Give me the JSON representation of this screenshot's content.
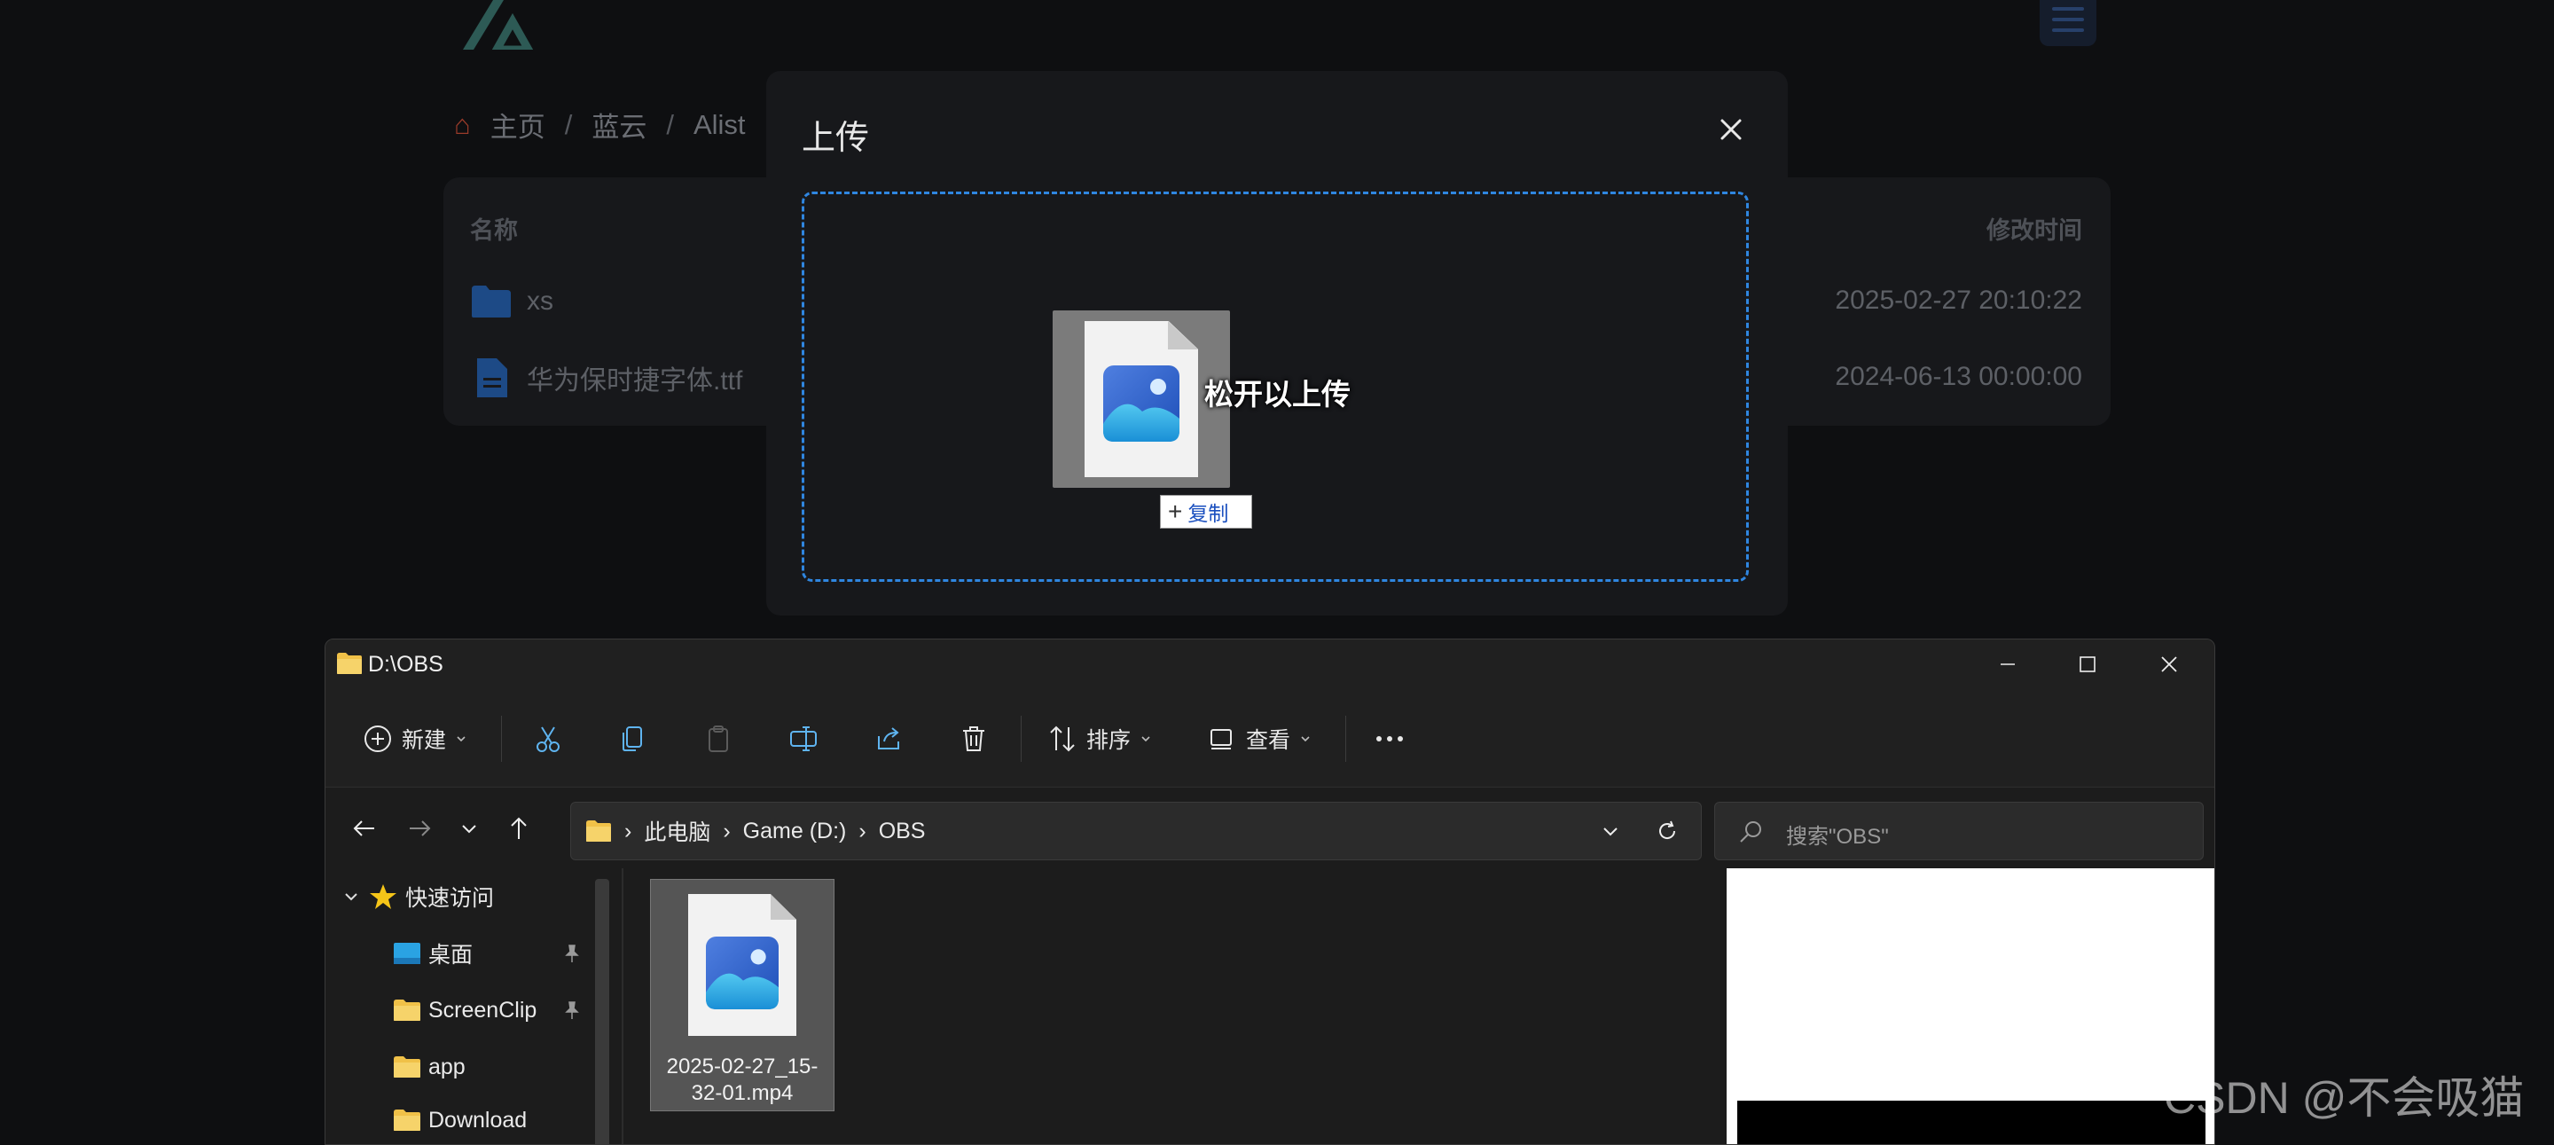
{
  "background_app": {
    "breadcrumbs": [
      "主页",
      "蓝云",
      "Alist"
    ],
    "columns": {
      "name": "名称",
      "modified": "修改时间"
    },
    "files": [
      {
        "name": "xs",
        "type": "folder",
        "modified": "2025-02-27 20:10:22"
      },
      {
        "name": "华为保时捷字体.ttf",
        "type": "file",
        "modified": "2024-06-13 00:00:00"
      }
    ]
  },
  "upload_modal": {
    "title": "上传",
    "drop_text": "松开以上传",
    "copy_badge": "复制",
    "accent_color": "#2f86e0"
  },
  "explorer": {
    "window_title": "D:\\OBS",
    "toolbar": {
      "new": "新建",
      "sort": "排序",
      "view": "查看"
    },
    "address": [
      "此电脑",
      "Game (D:)",
      "OBS"
    ],
    "search_placeholder": "搜索\"OBS\"",
    "nav": {
      "quick_access": "快速访问",
      "items": [
        "桌面",
        "ScreenClip",
        "app",
        "Download"
      ]
    },
    "files": [
      {
        "name": "2025-02-27_15-32-01.mp4"
      }
    ]
  },
  "watermark": "CSDN @不会吸猫"
}
